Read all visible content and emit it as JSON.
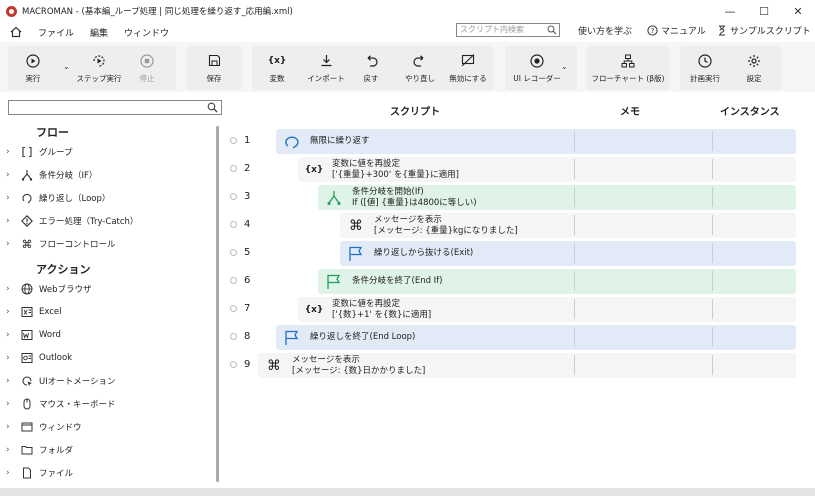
{
  "titlebar": {
    "title": "MACROMAN - (基本編_ループ処理 | 同じ処理を繰り返す_応用編.xml)"
  },
  "menu": {
    "file": "ファイル",
    "edit": "編集",
    "window": "ウィンドウ"
  },
  "search": {
    "placeholder": "スクリプト内検索"
  },
  "right_menu": {
    "learn": "使い方を学ぶ",
    "manual": "マニュアル",
    "samples": "サンプルスクリプト"
  },
  "toolbar": {
    "run": "実行",
    "step": "ステップ実行",
    "stop": "停止",
    "save": "保存",
    "variable": "変数",
    "import": "インポート",
    "undo": "戻す",
    "redo": "やり直し",
    "disable": "無効にする",
    "ui_recorder": "UI レコーダー",
    "flowchart": "フローチャート (β版)",
    "scheduled": "計画実行",
    "settings": "設定"
  },
  "sidebar": {
    "flow_title": "フロー",
    "flow_items": [
      "グループ",
      "条件分岐（IF）",
      "繰り返し（Loop）",
      "エラー処理（Try-Catch）",
      "フローコントロール"
    ],
    "action_title": "アクション",
    "action_items": [
      "Webブラウザ",
      "Excel",
      "Word",
      "Outlook",
      "UIオートメーション",
      "マウス・キーボード",
      "ウィンドウ",
      "フォルダ",
      "ファイル"
    ]
  },
  "columns": {
    "script": "スクリプト",
    "memo": "メモ",
    "instance": "インスタンス"
  },
  "rows": [
    {
      "num": "1",
      "line1": "無限に繰り返す",
      "line2": ""
    },
    {
      "num": "2",
      "line1": "変数に値を再設定",
      "line2": "['{重量}+300' を{重量}に適用]"
    },
    {
      "num": "3",
      "line1": "条件分岐を開始(If)",
      "line2": "If ([値] {重量}は4800に等しい)"
    },
    {
      "num": "4",
      "line1": "メッセージを表示",
      "line2": "[メッセージ: {重量}kgになりました]"
    },
    {
      "num": "5",
      "line1": "繰り返しから抜ける(Exit)",
      "line2": ""
    },
    {
      "num": "6",
      "line1": "条件分岐を終了(End If)",
      "line2": ""
    },
    {
      "num": "7",
      "line1": "変数に値を再設定",
      "line2": "['{数}+1' を{数}に適用]"
    },
    {
      "num": "8",
      "line1": "繰り返しを終了(End Loop)",
      "line2": ""
    },
    {
      "num": "9",
      "line1": "メッセージを表示",
      "line2": "[メッセージ: {数}日かかりました]"
    }
  ],
  "colors": {
    "loop": "#e3eaf7",
    "if": "#e0f3e8",
    "neutral": "#f5f5f5",
    "accent_blue": "#1a73c8",
    "accent_green": "#1e9e5a"
  }
}
